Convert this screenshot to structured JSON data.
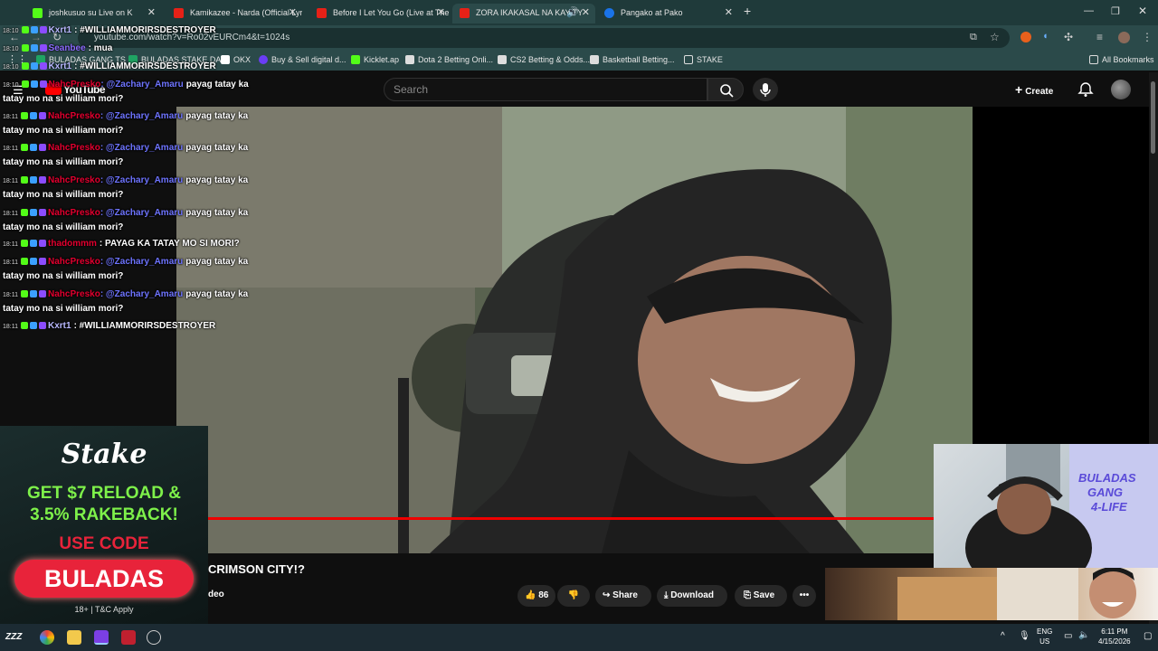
{
  "browser": {
    "tabs": [
      {
        "label": "joshkusuo su Live on K"
      },
      {
        "label": "Kamikazee - Narda (Official Lyr"
      },
      {
        "label": "Before I Let You Go (Live at The"
      },
      {
        "label": "ZORA IKAKASAL NA KAY TY"
      },
      {
        "label": "Pangako at Pako"
      }
    ],
    "new_tab": "+",
    "url": "youtube.com/watch?v=Ro02vEURCm4&t=1024s",
    "bookmarks": [
      {
        "label": "BULADAS GANG TS"
      },
      {
        "label": "BULADAS STAKE DA"
      },
      {
        "label": "OKX"
      },
      {
        "label": "Buy & Sell digital d..."
      },
      {
        "label": "Kicklet.ap"
      },
      {
        "label": "Dota 2 Betting Onli..."
      },
      {
        "label": "CS2 Betting & Odds..."
      },
      {
        "label": "Basketball Betting..."
      },
      {
        "label": "STAKE"
      }
    ],
    "all_bookmarks": "All Bookmarks"
  },
  "youtube": {
    "logo": "YouTube",
    "search_placeholder": "Search",
    "create_label": "Create",
    "title_fragment": "CRIMSON CITY!?",
    "sub_fragment": "deo",
    "like_count": "86",
    "share_label": "Share",
    "download_label": "Download",
    "save_label": "Save"
  },
  "chat": [
    {
      "time": "18:10",
      "user": "Kxrt1",
      "msg": ": #WILLIAMMORIRSDESTROYER",
      "user_color": "#b8b8ff"
    },
    {
      "time": "18:10",
      "user": "Seanbee",
      "msg": ": mua",
      "user_color": "#8c6cff"
    },
    {
      "time": "18:10",
      "user": "Kxrt1",
      "msg": ": #WILLIAMMORIRSDESTROYER",
      "user_color": "#b8b8ff"
    },
    {
      "time": "18:10",
      "user": "NahcPresko",
      "mention": ":  @Zachary_Amaru",
      "msg": "payag tatay ka",
      "cont": "tatay mo na si william mori?"
    },
    {
      "time": "18:11",
      "user": "NahcPresko",
      "mention": ":  @Zachary_Amaru",
      "msg": "payag tatay ka",
      "cont": "tatay mo na si william mori?"
    },
    {
      "time": "18:11",
      "user": "NahcPresko",
      "mention": ":  @Zachary_Amaru",
      "msg": "payag tatay ka",
      "cont": "tatay mo na si william mori?"
    },
    {
      "time": "18:11",
      "user": "NahcPresko",
      "mention": ":  @Zachary_Amaru",
      "msg": "payag tatay ka",
      "cont": "tatay mo na si william mori?"
    },
    {
      "time": "18:11",
      "user": "NahcPresko",
      "mention": ":  @Zachary_Amaru",
      "msg": "payag tatay ka",
      "cont": "tatay mo na si william mori?"
    },
    {
      "time": "18:11",
      "user": "thadommm",
      "msg": ": PAYAG KA TATAY MO SI MORI?",
      "user_color": "#e3002f"
    },
    {
      "time": "18:11",
      "user": "NahcPresko",
      "mention": ":  @Zachary_Amaru",
      "msg": "payag tatay ka",
      "cont": "tatay mo na si william mori?"
    },
    {
      "time": "18:11",
      "user": "NahcPresko",
      "mention": ":  @Zachary_Amaru",
      "msg": "payag tatay ka",
      "cont": "tatay mo na si william mori?"
    },
    {
      "time": "18:11",
      "user": "Kxrt1",
      "msg": ": #WILLIAMMORIRSDESTROYER",
      "user_color": "#b8b8ff"
    }
  ],
  "stake_ad": {
    "brand": "Stake",
    "line1": "GET $7 RELOAD &",
    "line2": "3.5% RAKEBACK!",
    "line3": "USE CODE",
    "code": "BULADAS",
    "fine": "18+ | T&C Apply"
  },
  "webcam_sign": {
    "line1": "BULADAS",
    "line2": "GANG",
    "line3": "4-LIFE"
  },
  "taskbar": {
    "lang1": "ENG",
    "lang2": "US",
    "time": "6:11 PM",
    "date": "4/15/2026"
  },
  "colors": {
    "yt_red": "#ff0000",
    "stake_green": "#2ecc71",
    "stake_red": "#e8233a",
    "chat_red": "#e3002f",
    "mention_blue": "#6e74ff"
  }
}
